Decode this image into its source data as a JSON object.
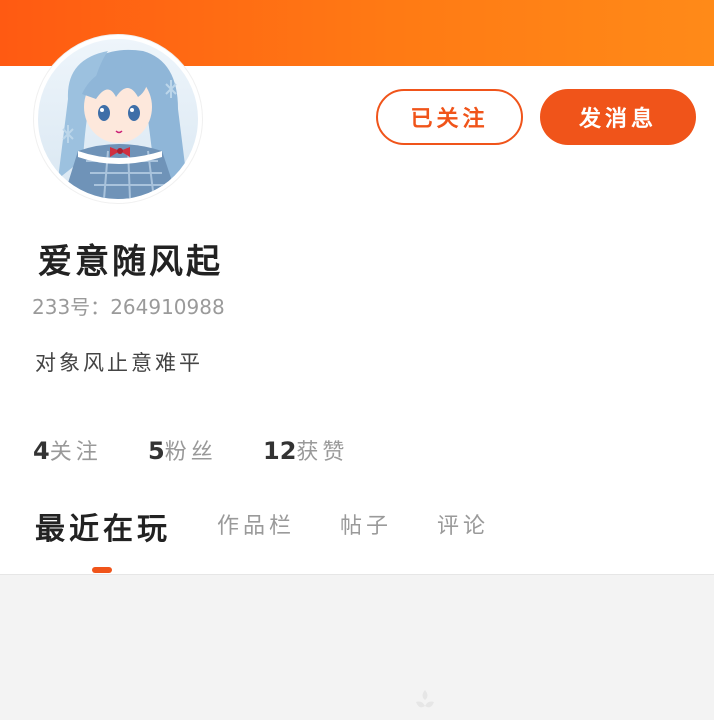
{
  "profile": {
    "username": "爱意随风起",
    "uid_label": "233号：",
    "uid_value": "264910988",
    "bio": "对象风止意难平"
  },
  "actions": {
    "following_label": "已关注",
    "message_label": "发消息"
  },
  "stats": [
    {
      "num": "4",
      "label": "关注"
    },
    {
      "num": "5",
      "label": "粉丝"
    },
    {
      "num": "12",
      "label": "获赞"
    }
  ],
  "tabs": [
    {
      "label": "最近在玩",
      "active": true
    },
    {
      "label": "作品栏",
      "active": false
    },
    {
      "label": "帖子",
      "active": false
    },
    {
      "label": "评论",
      "active": false
    }
  ],
  "colors": {
    "accent": "#f0541a",
    "banner_start": "#ff5a12",
    "banner_end": "#ff8a18"
  },
  "icons": {
    "avatar": "anime-girl-avatar-image",
    "loading": "loading-icon"
  }
}
